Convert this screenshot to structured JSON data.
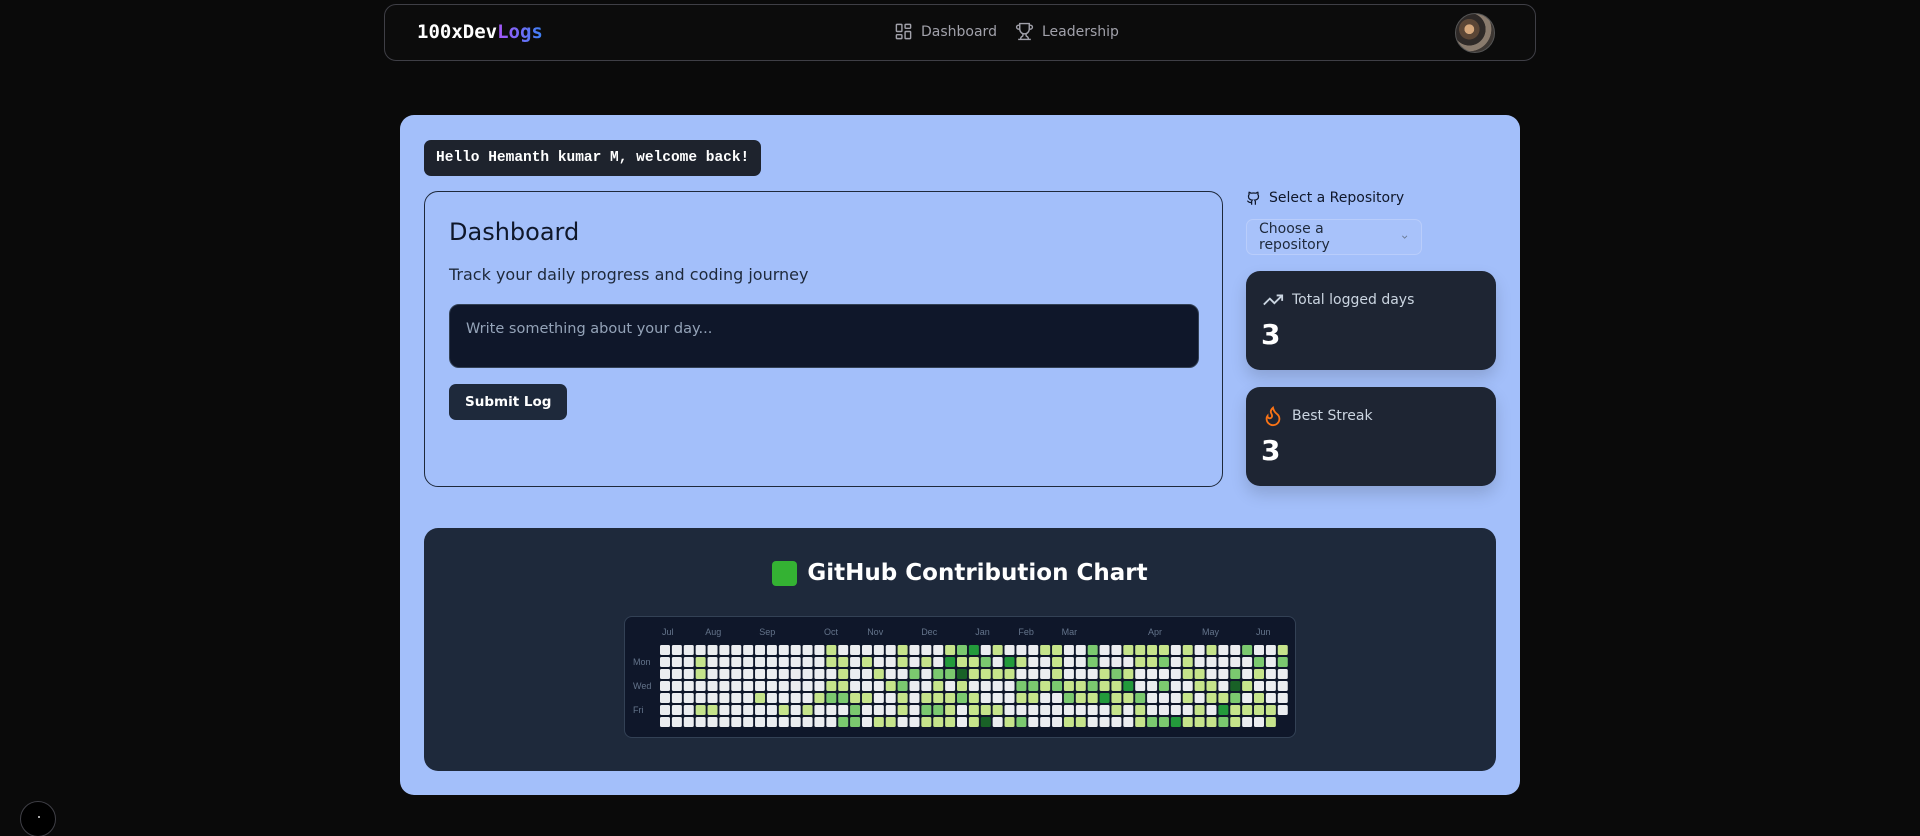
{
  "nav": {
    "brand_main": "100xDev",
    "brand_accent": "Logs",
    "links": [
      {
        "label": "Dashboard",
        "icon": "layout-grid-icon"
      },
      {
        "label": "Leadership",
        "icon": "trophy-icon"
      }
    ]
  },
  "welcome": "Hello Hemanth kumar M, welcome back!",
  "dashboard": {
    "title": "Dashboard",
    "subtitle": "Track your daily progress and coding journey",
    "input_placeholder": "Write something about your day...",
    "submit_label": "Submit Log"
  },
  "repo": {
    "label": "Select a Repository",
    "placeholder": "Choose a repository"
  },
  "stats": [
    {
      "label": "Total logged days",
      "value": "3",
      "icon": "trending-up-icon"
    },
    {
      "label": "Best Streak",
      "value": "3",
      "icon": "flame-icon"
    }
  ],
  "contributions": {
    "title": "GitHub Contribution Chart",
    "title_emoji": "green-square",
    "months": [
      "Jul",
      "Aug",
      "Sep",
      "Oct",
      "Nov",
      "Dec",
      "Jan",
      "Feb",
      "Mar",
      "Apr",
      "May",
      "Jun"
    ],
    "day_labels": [
      "Mon",
      "Wed",
      "Fri"
    ],
    "colors": [
      "#ebedf0",
      "#c6e48b",
      "#7bc96f",
      "#239a3b",
      "#196127"
    ]
  }
}
